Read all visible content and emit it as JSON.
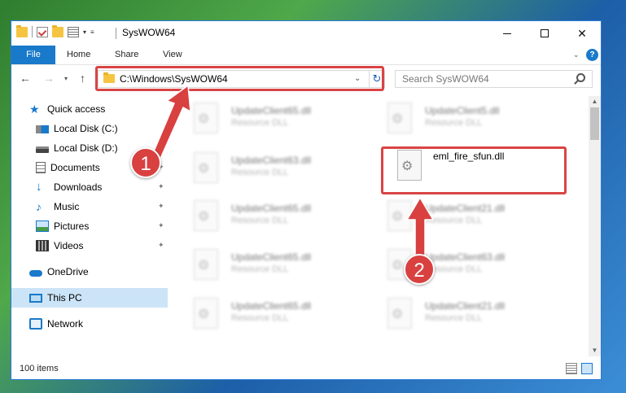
{
  "window": {
    "title": "SysWOW64",
    "controls": {
      "minimize": "—",
      "maximize": "☐",
      "close": "✕"
    }
  },
  "ribbon": {
    "tabs": [
      "File",
      "Home",
      "Share",
      "View"
    ],
    "help": "?"
  },
  "navigation": {
    "back": "←",
    "forward": "→",
    "recent": "▾",
    "up": "↑",
    "address": "C:\\Windows\\SysWOW64",
    "address_dropdown": "⌄",
    "refresh": "↻",
    "search_placeholder": "Search SysWOW64"
  },
  "sidebar": {
    "items": [
      {
        "label": "Quick access",
        "icon": "star-icon",
        "pinned": false
      },
      {
        "label": "Local Disk (C:)",
        "icon": "drive-c-icon",
        "pinned": false
      },
      {
        "label": "Local Disk (D:)",
        "icon": "drive-d-icon",
        "pinned": true
      },
      {
        "label": "Documents",
        "icon": "documents-icon",
        "pinned": true
      },
      {
        "label": "Downloads",
        "icon": "downloads-icon",
        "pinned": true
      },
      {
        "label": "Music",
        "icon": "music-icon",
        "pinned": true
      },
      {
        "label": "Pictures",
        "icon": "pictures-icon",
        "pinned": true
      },
      {
        "label": "Videos",
        "icon": "videos-icon",
        "pinned": true
      },
      {
        "label": "OneDrive",
        "icon": "onedrive-icon",
        "pinned": false
      },
      {
        "label": "This PC",
        "icon": "this-pc-icon",
        "pinned": false,
        "selected": true
      },
      {
        "label": "Network",
        "icon": "network-icon",
        "pinned": false
      }
    ],
    "pin_glyph": "📌"
  },
  "files": [
    {
      "name": "UpdateClient65.dll",
      "type": "Resource DLL",
      "blurred": true
    },
    {
      "name": "UpdateClient5.dll",
      "type": "Resource DLL",
      "blurred": true
    },
    {
      "name": "UpdateClient63.dll",
      "type": "Resource DLL",
      "blurred": true
    },
    {
      "name": "eml_fire_sfun.dll",
      "type": "",
      "blurred": false
    },
    {
      "name": "UpdateClient65.dll",
      "type": "Resource DLL",
      "blurred": true
    },
    {
      "name": "UpdateClient21.dll",
      "type": "Resource DLL",
      "blurred": true
    },
    {
      "name": "UpdateClient65.dll",
      "type": "Resource DLL",
      "blurred": true
    },
    {
      "name": "UpdateClient63.dll",
      "type": "Resource DLL",
      "blurred": true
    },
    {
      "name": "UpdateClient65.dll",
      "type": "Resource DLL",
      "blurred": true
    },
    {
      "name": "UpdateClient21.dll",
      "type": "Resource DLL",
      "blurred": true
    }
  ],
  "status": {
    "item_count": "100 items"
  },
  "annotations": {
    "step1": "1",
    "step2": "2",
    "color": "#d94040"
  },
  "colors": {
    "accent": "#1979ca",
    "selection": "#cce4f7",
    "highlight": "#d94444"
  }
}
